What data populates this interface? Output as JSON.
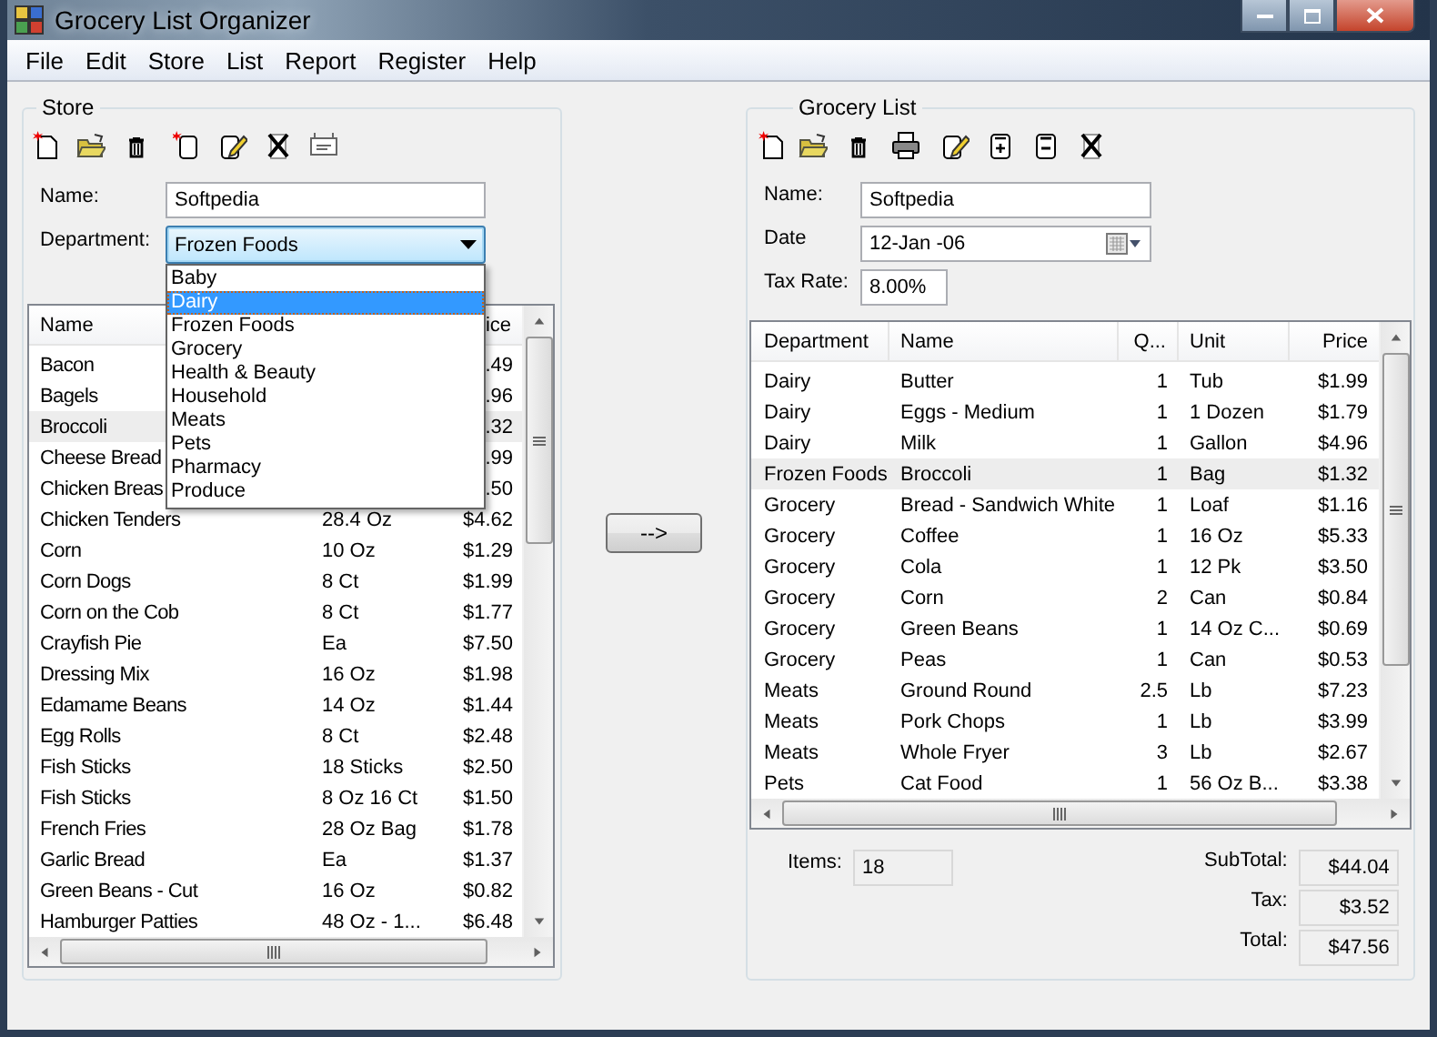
{
  "window": {
    "title": "Grocery List Organizer"
  },
  "menu": [
    "File",
    "Edit",
    "Store",
    "List",
    "Report",
    "Register",
    "Help"
  ],
  "store": {
    "title": "Store",
    "name_label": "Name:",
    "name_value": "Softpedia",
    "department_label": "Department:",
    "department_value": "Frozen Foods",
    "department_dropdown": {
      "expanded": true,
      "options": [
        {
          "label": "Baby",
          "selected": false
        },
        {
          "label": "Dairy",
          "selected": true
        },
        {
          "label": "Frozen Foods",
          "selected": false
        },
        {
          "label": "Grocery",
          "selected": false
        },
        {
          "label": "Health & Beauty",
          "selected": false
        },
        {
          "label": "Household",
          "selected": false
        },
        {
          "label": "Meats",
          "selected": false
        },
        {
          "label": "Pets",
          "selected": false
        },
        {
          "label": "Pharmacy",
          "selected": false
        },
        {
          "label": "Produce",
          "selected": false
        }
      ]
    },
    "items": {
      "columns": {
        "name": "Name",
        "price": "ice"
      },
      "rows": [
        {
          "name": "Bacon",
          "price": ".49",
          "selected": false
        },
        {
          "name": "Bagels",
          "price": ".96",
          "selected": false
        },
        {
          "name": "Broccoli",
          "price": ".32",
          "selected": true
        },
        {
          "name": "Cheese Bread",
          "price": ".99",
          "selected": false
        },
        {
          "name": "Chicken Breas",
          "price": ".50",
          "selected": false
        },
        {
          "name": "Chicken Tenders",
          "unit": "28.4 Oz",
          "price": "$4.62",
          "selected": false
        },
        {
          "name": "Corn",
          "unit": "10 Oz",
          "price": "$1.29",
          "selected": false
        },
        {
          "name": "Corn Dogs",
          "unit": "8 Ct",
          "price": "$1.99",
          "selected": false
        },
        {
          "name": "Corn on the Cob",
          "unit": "8 Ct",
          "price": "$1.77",
          "selected": false
        },
        {
          "name": "Crayfish Pie",
          "unit": "Ea",
          "price": "$7.50",
          "selected": false
        },
        {
          "name": "Dressing Mix",
          "unit": "16 Oz",
          "price": "$1.98",
          "selected": false
        },
        {
          "name": "Edamame Beans",
          "unit": "14 Oz",
          "price": "$1.44",
          "selected": false
        },
        {
          "name": "Egg Rolls",
          "unit": "8 Ct",
          "price": "$2.48",
          "selected": false
        },
        {
          "name": "Fish Sticks",
          "unit": "18 Sticks",
          "price": "$2.50",
          "selected": false
        },
        {
          "name": "Fish Sticks",
          "unit": "8 Oz 16 Ct",
          "price": "$1.50",
          "selected": false
        },
        {
          "name": "French Fries",
          "unit": "28 Oz Bag",
          "price": "$1.78",
          "selected": false
        },
        {
          "name": "Garlic Bread",
          "unit": "Ea",
          "price": "$1.37",
          "selected": false
        },
        {
          "name": "Green Beans - Cut",
          "unit": "16 Oz",
          "price": "$0.82",
          "selected": false
        },
        {
          "name": "Hamburger Patties",
          "unit": "48 Oz - 1...",
          "price": "$6.48",
          "selected": false
        }
      ]
    }
  },
  "transfer_button": "-->",
  "grocery_list": {
    "title": "Grocery List",
    "name_label": "Name:",
    "name_value": "Softpedia",
    "date_label": "Date",
    "date_value": "12-Jan -06",
    "tax_rate_label": "Tax Rate:",
    "tax_rate_value": "8.00%",
    "columns": [
      "Department",
      "Name",
      "Q...",
      "Unit",
      "Price"
    ],
    "rows": [
      {
        "department": "Dairy",
        "name": "Butter",
        "quantity": "1",
        "unit": "Tub",
        "price": "$1.99",
        "selected": false
      },
      {
        "department": "Dairy",
        "name": "Eggs - Medium",
        "quantity": "1",
        "unit": "1 Dozen",
        "price": "$1.79",
        "selected": false
      },
      {
        "department": "Dairy",
        "name": "Milk",
        "quantity": "1",
        "unit": "Gallon",
        "price": "$4.96",
        "selected": false
      },
      {
        "department": "Frozen Foods",
        "name": "Broccoli",
        "quantity": "1",
        "unit": "Bag",
        "price": "$1.32",
        "selected": true
      },
      {
        "department": "Grocery",
        "name": "Bread - Sandwich White",
        "quantity": "1",
        "unit": "Loaf",
        "price": "$1.16",
        "selected": false
      },
      {
        "department": "Grocery",
        "name": "Coffee",
        "quantity": "1",
        "unit": "16 Oz",
        "price": "$5.33",
        "selected": false
      },
      {
        "department": "Grocery",
        "name": "Cola",
        "quantity": "1",
        "unit": "12 Pk",
        "price": "$3.50",
        "selected": false
      },
      {
        "department": "Grocery",
        "name": "Corn",
        "quantity": "2",
        "unit": "Can",
        "price": "$0.84",
        "selected": false
      },
      {
        "department": "Grocery",
        "name": "Green Beans",
        "quantity": "1",
        "unit": "14 Oz C...",
        "price": "$0.69",
        "selected": false
      },
      {
        "department": "Grocery",
        "name": "Peas",
        "quantity": "1",
        "unit": "Can",
        "price": "$0.53",
        "selected": false
      },
      {
        "department": "Meats",
        "name": "Ground Round",
        "quantity": "2.5",
        "unit": "Lb",
        "price": "$7.23",
        "selected": false
      },
      {
        "department": "Meats",
        "name": "Pork Chops",
        "quantity": "1",
        "unit": "Lb",
        "price": "$3.99",
        "selected": false
      },
      {
        "department": "Meats",
        "name": "Whole Fryer",
        "quantity": "3",
        "unit": "Lb",
        "price": "$2.67",
        "selected": false
      },
      {
        "department": "Pets",
        "name": "Cat Food",
        "quantity": "1",
        "unit": "56 Oz B...",
        "price": "$3.38",
        "selected": false
      }
    ],
    "items_label": "Items:",
    "items_value": "18",
    "subtotal_label": "SubTotal:",
    "subtotal_value": "$44.04",
    "tax_label": "Tax:",
    "tax_value": "$3.52",
    "total_label": "Total:",
    "total_value": "$47.56"
  }
}
